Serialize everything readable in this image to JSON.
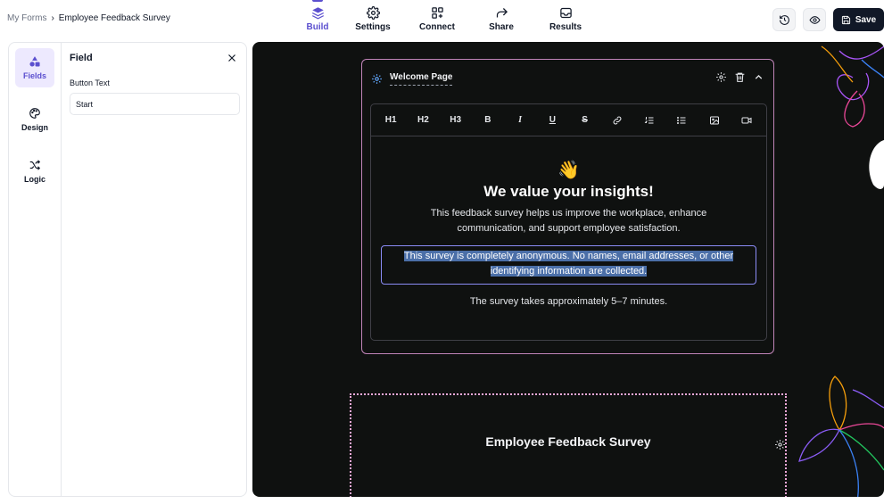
{
  "breadcrumb": {
    "parent": "My Forms",
    "separator": "›",
    "current": "Employee Feedback Survey"
  },
  "nav_tabs": [
    {
      "label": "Build",
      "icon": "layers-icon",
      "active": true
    },
    {
      "label": "Settings",
      "icon": "gear-icon",
      "active": false
    },
    {
      "label": "Connect",
      "icon": "integrations-icon",
      "active": false
    },
    {
      "label": "Share",
      "icon": "share-arrow-icon",
      "active": false
    },
    {
      "label": "Results",
      "icon": "inbox-icon",
      "active": false
    }
  ],
  "actions": {
    "history_icon": "history-icon",
    "preview_icon": "eye-icon",
    "save_label": "Save"
  },
  "side_rail": [
    {
      "label": "Fields",
      "icon": "shapes-icon",
      "active": true
    },
    {
      "label": "Design",
      "icon": "palette-icon",
      "active": false
    },
    {
      "label": "Logic",
      "icon": "shuffle-icon",
      "active": false
    }
  ],
  "field_panel": {
    "title": "Field",
    "button_text_label": "Button Text",
    "button_text_value": "Start"
  },
  "welcome_card": {
    "title": "Welcome Page",
    "toolbar": [
      "H1",
      "H2",
      "H3",
      "B",
      "I",
      "U",
      "S",
      "link",
      "ordered-list",
      "bullet-list",
      "image",
      "video"
    ],
    "emoji": "👋",
    "headline": "We value your insights!",
    "paragraph": "This feedback survey helps us improve the workplace, enhance communication, and support employee satisfaction.",
    "anonymity_line1": "This survey is completely anonymous. No names, email addresses, or other",
    "anonymity_line2": "identifying information are collected.",
    "duration": "The survey takes approximately 5–7 minutes."
  },
  "cover_card": {
    "title": "Employee Feedback Survey"
  },
  "colors": {
    "accent": "#5b4fcf",
    "canvas_bg": "#0f1110",
    "card_border": "#c084b8",
    "selection_border": "#8b8cf6",
    "highlight": "#4b6fa8"
  }
}
